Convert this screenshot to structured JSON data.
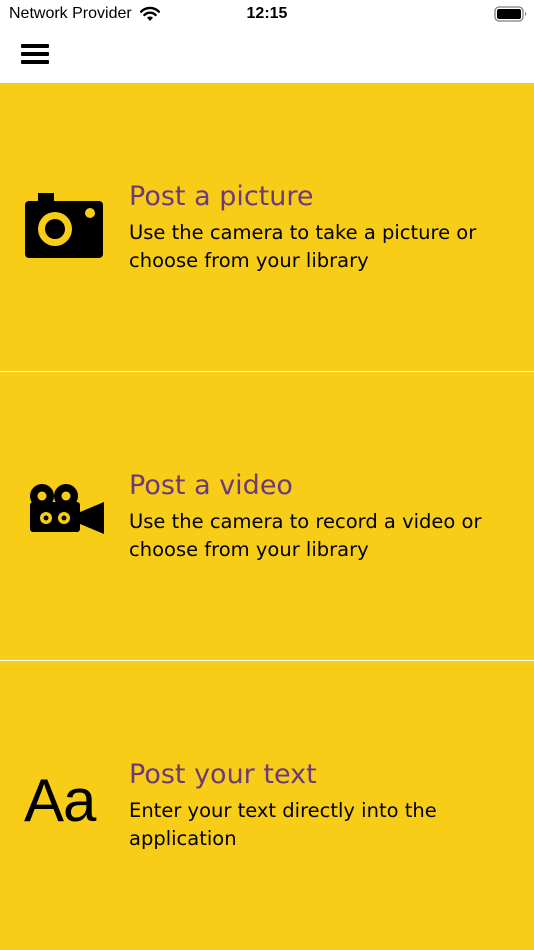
{
  "status_bar": {
    "carrier": "Network Provider",
    "time": "12:15"
  },
  "nav": {
    "menu_icon": "hamburger-menu-icon"
  },
  "options": [
    {
      "icon": "camera-icon",
      "title": "Post a picture",
      "description": "Use the camera to take a picture or choose from your library"
    },
    {
      "icon": "video-camera-icon",
      "title": "Post a video",
      "description": "Use the camera to record a video or choose from your library"
    },
    {
      "icon": "text-icon",
      "icon_text": "Aa",
      "title": "Post your text",
      "description": "Enter your text directly into the application"
    }
  ],
  "colors": {
    "background": "#f8cd17",
    "title": "#6b3a7d",
    "icon": "#000000"
  }
}
